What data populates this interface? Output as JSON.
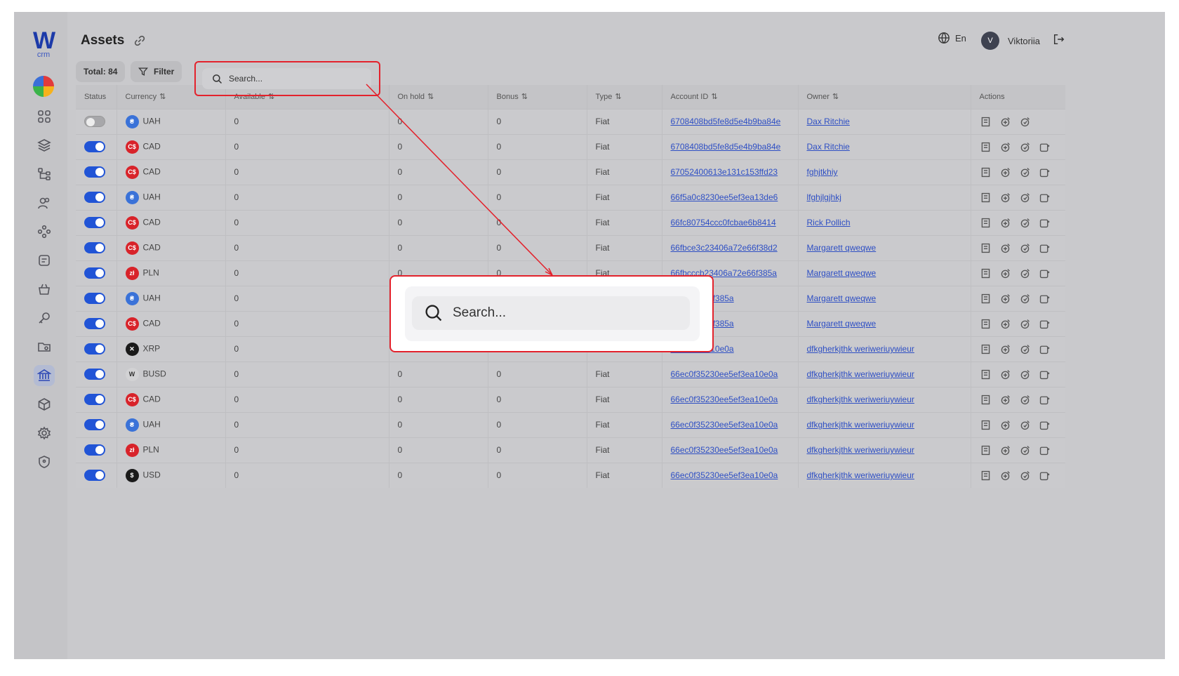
{
  "app": {
    "logo_letter": "W",
    "logo_sub": "crm"
  },
  "header": {
    "title": "Assets",
    "language": "En",
    "user_initial": "V",
    "user_name": "Viktoriia"
  },
  "toolbar": {
    "total_label": "Total: 84",
    "filter_label": "Filter",
    "search_placeholder": "Search..."
  },
  "sidebar": {
    "items": [
      "dashboard",
      "layers",
      "hierarchy",
      "users",
      "groups",
      "tasks",
      "basket",
      "key",
      "folder",
      "bank",
      "box",
      "settings",
      "shield"
    ],
    "active": "bank"
  },
  "table": {
    "columns": [
      "Status",
      "Currency",
      "Available",
      "On hold",
      "Bonus",
      "Type",
      "Account ID",
      "Owner",
      "Actions"
    ],
    "rows": [
      {
        "on": false,
        "currency": "UAH",
        "available": "0",
        "on_hold": "0",
        "bonus": "0",
        "type": "Fiat",
        "account_id": "6708408bd5fe8d5e4b9ba84e",
        "owner": "Dax Ritchie",
        "actions": 3
      },
      {
        "on": true,
        "currency": "CAD",
        "available": "0",
        "on_hold": "0",
        "bonus": "0",
        "type": "Fiat",
        "account_id": "6708408bd5fe8d5e4b9ba84e",
        "owner": "Dax Ritchie",
        "actions": 4
      },
      {
        "on": true,
        "currency": "CAD",
        "available": "0",
        "on_hold": "0",
        "bonus": "0",
        "type": "Fiat",
        "account_id": "67052400613e131c153ffd23",
        "owner": "fghjtkhiy",
        "actions": 4
      },
      {
        "on": true,
        "currency": "UAH",
        "available": "0",
        "on_hold": "0",
        "bonus": "0",
        "type": "Fiat",
        "account_id": "66f5a0c8230ee5ef3ea13de6",
        "owner": "lfghjlgjhkj",
        "actions": 4
      },
      {
        "on": true,
        "currency": "CAD",
        "available": "0",
        "on_hold": "0",
        "bonus": "0",
        "type": "Fiat",
        "account_id": "66fc80754ccc0fcbae6b8414",
        "owner": "Rick Pollich",
        "actions": 4
      },
      {
        "on": true,
        "currency": "CAD",
        "available": "0",
        "on_hold": "0",
        "bonus": "0",
        "type": "Fiat",
        "account_id": "66fbce3c23406a72e66f38d2",
        "owner": "Margarett qweqwe",
        "actions": 4
      },
      {
        "on": true,
        "currency": "PLN",
        "available": "0",
        "on_hold": "0",
        "bonus": "0",
        "type": "Fiat",
        "account_id": "66fbcccb23406a72e66f385a",
        "owner": "Margarett qweqwe",
        "actions": 4
      },
      {
        "on": true,
        "currency": "UAH",
        "available": "0",
        "on_hold": "",
        "bonus": "",
        "type": "",
        "account_id": "406a72e66f385a",
        "owner": "Margarett qweqwe",
        "actions": 4
      },
      {
        "on": true,
        "currency": "CAD",
        "available": "0",
        "on_hold": "",
        "bonus": "",
        "type": "",
        "account_id": "406a72e66f385a",
        "owner": "Margarett qweqwe",
        "actions": 4
      },
      {
        "on": true,
        "currency": "XRP",
        "available": "0",
        "on_hold": "",
        "bonus": "",
        "type": "",
        "account_id": "0ee5ef3ea10e0a",
        "owner": "dfkgherkjthk weriweriuywieur",
        "actions": 4
      },
      {
        "on": true,
        "currency": "BUSD",
        "available": "0",
        "on_hold": "0",
        "bonus": "0",
        "type": "Fiat",
        "account_id": "66ec0f35230ee5ef3ea10e0a",
        "owner": "dfkgherkjthk weriweriuywieur",
        "actions": 4
      },
      {
        "on": true,
        "currency": "CAD",
        "available": "0",
        "on_hold": "0",
        "bonus": "0",
        "type": "Fiat",
        "account_id": "66ec0f35230ee5ef3ea10e0a",
        "owner": "dfkgherkjthk weriweriuywieur",
        "actions": 4
      },
      {
        "on": true,
        "currency": "UAH",
        "available": "0",
        "on_hold": "0",
        "bonus": "0",
        "type": "Fiat",
        "account_id": "66ec0f35230ee5ef3ea10e0a",
        "owner": "dfkgherkjthk weriweriuywieur",
        "actions": 4
      },
      {
        "on": true,
        "currency": "PLN",
        "available": "0",
        "on_hold": "0",
        "bonus": "0",
        "type": "Fiat",
        "account_id": "66ec0f35230ee5ef3ea10e0a",
        "owner": "dfkgherkjthk weriweriuywieur",
        "actions": 4
      },
      {
        "on": true,
        "currency": "USD",
        "available": "0",
        "on_hold": "0",
        "bonus": "0",
        "type": "Fiat",
        "account_id": "66ec0f35230ee5ef3ea10e0a",
        "owner": "dfkgherkjthk weriweriuywieur",
        "actions": 4
      }
    ]
  },
  "currency_icons": {
    "UAH": {
      "glyph": "₴",
      "color": "#3a72d8"
    },
    "CAD": {
      "glyph": "C$",
      "color": "#d8232a"
    },
    "PLN": {
      "glyph": "zł",
      "color": "#d8232a"
    },
    "XRP": {
      "glyph": "✕",
      "color": "#1a1a1a"
    },
    "BUSD": {
      "glyph": "W",
      "color": "#d2d2d4"
    },
    "USD": {
      "glyph": "$",
      "color": "#1a1a1a"
    }
  },
  "colors": {
    "accent": "#2154d6",
    "highlight": "#e3222c",
    "link": "#2e4fc4"
  }
}
